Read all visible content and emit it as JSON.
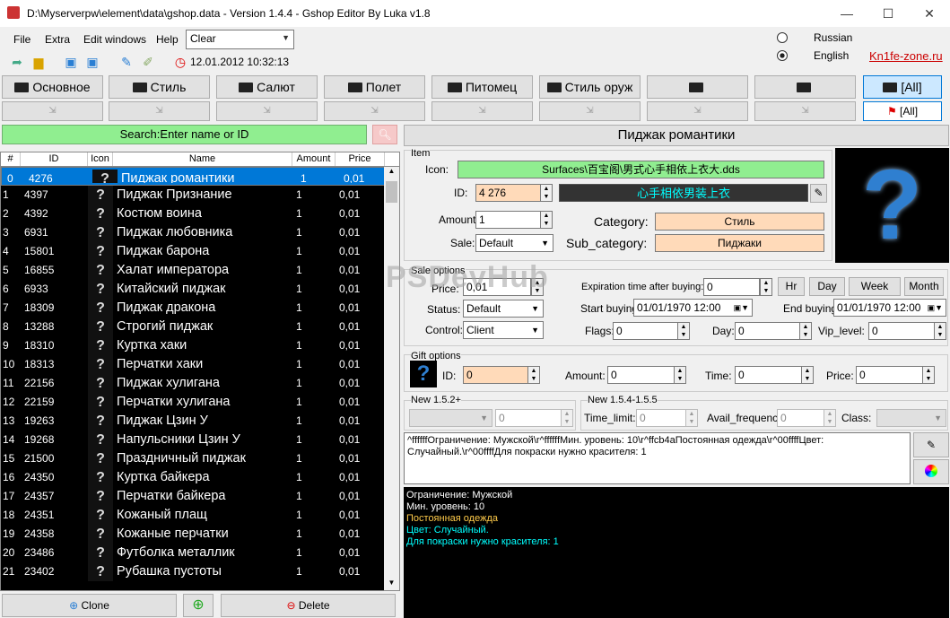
{
  "window": {
    "title": "D:\\Myserverpw\\element\\data\\gshop.data   -   Version 1.4.4   -   Gshop Editor By Luka v1.8",
    "minimize": "—",
    "maximize": "☐",
    "close": "✕"
  },
  "menu": {
    "file": "File",
    "extra": "Extra",
    "edit_windows": "Edit windows",
    "help": "Help",
    "filter_select": "Clear"
  },
  "toolbar": {
    "timestamp": "12.01.2012 10:32:13"
  },
  "language": {
    "russian": "Russian",
    "english": "English",
    "selected": "English",
    "link": "Kn1fe-zone.ru"
  },
  "categories": [
    "Основное",
    "Стиль",
    "Салют",
    "Полет",
    "Питомец",
    "Стиль оруж",
    "",
    "",
    "[All]"
  ],
  "categories2_all": "[All]",
  "search": {
    "placeholder": "Search:Enter name or ID"
  },
  "grid": {
    "headers": {
      "num": "#",
      "id": "ID",
      "icon": "Icon",
      "name": "Name",
      "amount": "Amount",
      "price": "Price"
    },
    "icon_glyph": "?",
    "rows": [
      {
        "n": "0",
        "id": "4276",
        "name": "Пиджак романтики",
        "amount": "1",
        "price": "0,01"
      },
      {
        "n": "1",
        "id": "4397",
        "name": "Пиджак Признание",
        "amount": "1",
        "price": "0,01"
      },
      {
        "n": "2",
        "id": "4392",
        "name": "Костюм воина",
        "amount": "1",
        "price": "0,01"
      },
      {
        "n": "3",
        "id": "6931",
        "name": "Пиджак любовника",
        "amount": "1",
        "price": "0,01"
      },
      {
        "n": "4",
        "id": "15801",
        "name": "Пиджак барона",
        "amount": "1",
        "price": "0,01"
      },
      {
        "n": "5",
        "id": "16855",
        "name": "Халат императора",
        "amount": "1",
        "price": "0,01"
      },
      {
        "n": "6",
        "id": "6933",
        "name": "Китайский пиджак",
        "amount": "1",
        "price": "0,01"
      },
      {
        "n": "7",
        "id": "18309",
        "name": "Пиджак дракона",
        "amount": "1",
        "price": "0,01"
      },
      {
        "n": "8",
        "id": "13288",
        "name": "Строгий пиджак",
        "amount": "1",
        "price": "0,01"
      },
      {
        "n": "9",
        "id": "18310",
        "name": "Куртка хаки",
        "amount": "1",
        "price": "0,01"
      },
      {
        "n": "10",
        "id": "18313",
        "name": "Перчатки хаки",
        "amount": "1",
        "price": "0,01"
      },
      {
        "n": "11",
        "id": "22156",
        "name": "Пиджак хулигана",
        "amount": "1",
        "price": "0,01"
      },
      {
        "n": "12",
        "id": "22159",
        "name": "Перчатки хулигана",
        "amount": "1",
        "price": "0,01"
      },
      {
        "n": "13",
        "id": "19263",
        "name": "Пиджак Цзин У",
        "amount": "1",
        "price": "0,01"
      },
      {
        "n": "14",
        "id": "19268",
        "name": "Напульсники Цзин У",
        "amount": "1",
        "price": "0,01"
      },
      {
        "n": "15",
        "id": "21500",
        "name": "Праздничный пиджак",
        "amount": "1",
        "price": "0,01"
      },
      {
        "n": "16",
        "id": "24350",
        "name": "Куртка байкера",
        "amount": "1",
        "price": "0,01"
      },
      {
        "n": "17",
        "id": "24357",
        "name": "Перчатки байкера",
        "amount": "1",
        "price": "0,01"
      },
      {
        "n": "18",
        "id": "24351",
        "name": "Кожаный плащ",
        "amount": "1",
        "price": "0,01"
      },
      {
        "n": "19",
        "id": "24358",
        "name": "Кожаные перчатки",
        "amount": "1",
        "price": "0,01"
      },
      {
        "n": "20",
        "id": "23486",
        "name": "Футболка металлик",
        "amount": "1",
        "price": "0,01"
      },
      {
        "n": "21",
        "id": "23402",
        "name": "Рубашка пустоты",
        "amount": "1",
        "price": "0,01"
      }
    ]
  },
  "bottom": {
    "clone": "Clone",
    "delete": "Delete"
  },
  "item": {
    "title": "Пиджак романтики",
    "group": "Item",
    "icon_label": "Icon:",
    "icon_path": "Surfaces\\百宝阁\\男式心手相依上衣大.dds",
    "id_label": "ID:",
    "id": "4 276",
    "chinese_name": "心手相依男装上衣",
    "amount_label": "Amount:",
    "amount": "1",
    "sale_label": "Sale:",
    "sale": "Default",
    "category_label": "Category:",
    "category": "Стиль",
    "subcategory_label": "Sub_category:",
    "subcategory": "Пиджаки",
    "preview_glyph": "?"
  },
  "sale_options": {
    "group": "Sale options",
    "price_label": "Price:",
    "price": "0,01",
    "status_label": "Status:",
    "status": "Default",
    "control_label": "Control:",
    "control": "Client",
    "exp_label": "Expiration time after buying:",
    "exp": "0",
    "hr": "Hr",
    "day": "Day",
    "week": "Week",
    "month": "Month",
    "start_label": "Start buying:",
    "start": "01/01/1970 12:00",
    "end_label": "End buying:",
    "end": "01/01/1970 12:00",
    "flags_label": "Flags:",
    "flags": "0",
    "dayf_label": "Day:",
    "dayf": "0",
    "vip_label": "Vip_level:",
    "vip": "0"
  },
  "gift": {
    "group": "Gift options",
    "id_label": "ID:",
    "id": "0",
    "amount_label": "Amount:",
    "amount": "0",
    "time_label": "Time:",
    "time": "0",
    "price_label": "Price:",
    "price": "0"
  },
  "new152": {
    "group": "New 1.5.2+",
    "value": "0"
  },
  "new154": {
    "group": "New 1.5.4-1.5.5",
    "time_limit_label": "Time_limit:",
    "time_limit": "0",
    "avail_label": "Avail_frequency:",
    "avail": "0",
    "class_label": "Class:"
  },
  "description": "^ffffffОграничение: Мужской\\r^ffffffМин. уровень: 10\\r^ffcb4aПостоянная одежда\\r^00ffffЦвет: Случайный.\\r^00ffffДля покраски нужно красителя: 1",
  "output": [
    {
      "text": "Ограничение: Мужской",
      "color": "#ffffff"
    },
    {
      "text": "Мин. уровень: 10",
      "color": "#ffffff"
    },
    {
      "text": "Постоянная одежда",
      "color": "#ffcb4a"
    },
    {
      "text": "Цвет: Случайный.",
      "color": "#00ffff"
    },
    {
      "text": "Для покраски нужно красителя: 1",
      "color": "#00ffff"
    }
  ],
  "watermark": "PSDevHub"
}
